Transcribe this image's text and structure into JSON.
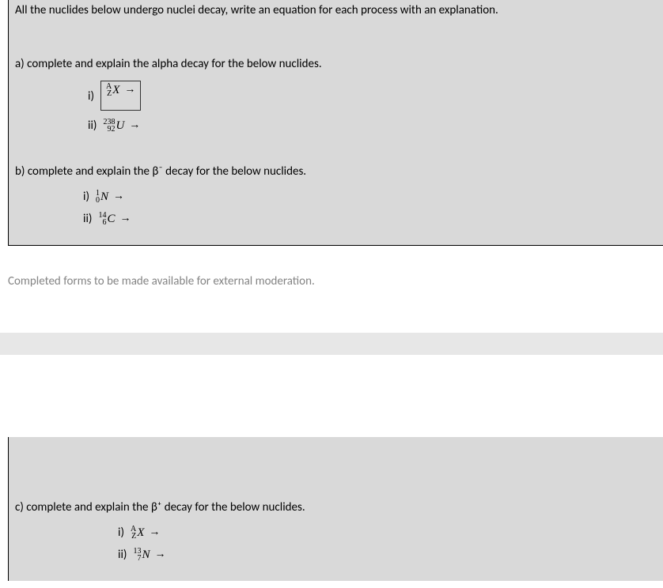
{
  "intro": "All the nuclides below undergo nuclei decay, write an equation for each process with an explanation.",
  "partA": {
    "header": "a) complete and explain the alpha decay for the below nuclides.",
    "items": [
      {
        "label": "i)",
        "sup": "A",
        "sub": "Z",
        "elem": "X",
        "arrow": "→",
        "boxed": true
      },
      {
        "label": "ii)",
        "sup": "238",
        "sub": "92",
        "elem": "U",
        "arrow": "→",
        "boxed": false
      }
    ]
  },
  "partB": {
    "header": "b) complete and explain the β⁻ decay for the below nuclides.",
    "items": [
      {
        "label": "i)",
        "sup": "1",
        "sub": "0",
        "elem": "N",
        "arrow": "→"
      },
      {
        "label": "ii)",
        "sup": "14",
        "sub": "6",
        "elem": "C",
        "arrow": "→"
      }
    ]
  },
  "moderation": "Completed forms to be made available for external moderation.",
  "partC": {
    "header": "c)  complete and explain the β⁺ decay for the below nuclides.",
    "items": [
      {
        "label": "i)",
        "sup": "A",
        "sub": "Z",
        "elem": "X",
        "arrow": "→"
      },
      {
        "label": "ii)",
        "sup": "13",
        "sub": "7",
        "elem": "N",
        "arrow": "→"
      }
    ]
  }
}
